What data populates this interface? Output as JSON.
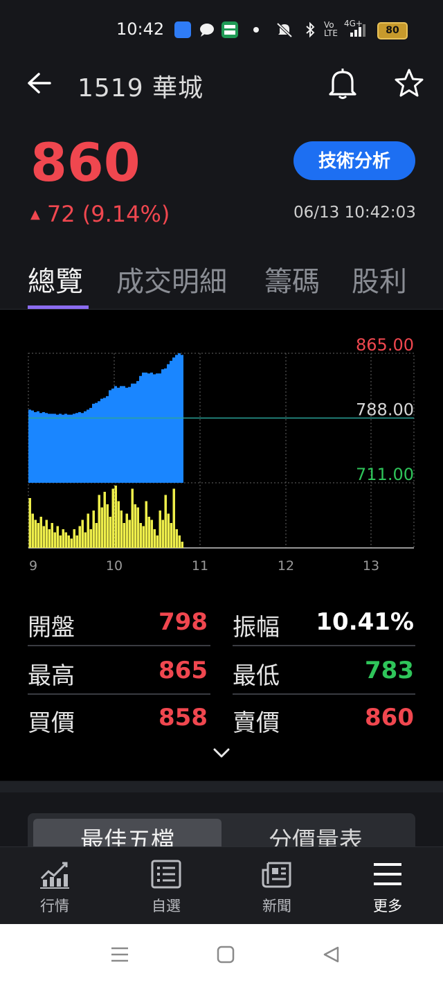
{
  "status_bar": {
    "time": "10:42",
    "volte_label": "Vo LTE",
    "network_label": "4G+",
    "battery": "80"
  },
  "header": {
    "title": "1519 華城"
  },
  "quote": {
    "price": "860",
    "change": "72 (9.14%)",
    "timestamp": "06/13 10:42:03",
    "tech_button": "技術分析",
    "colors": {
      "up": "#f0474f",
      "down": "#2fc55a",
      "accent": "#1d6ff2"
    }
  },
  "tabs": [
    {
      "label": "總覽",
      "active": true
    },
    {
      "label": "成交明細",
      "active": false
    },
    {
      "label": "籌碼",
      "active": false
    },
    {
      "label": "股利",
      "active": false
    }
  ],
  "chart_data": {
    "type": "area",
    "title": "",
    "y_labels": [
      "865.00",
      "788.00",
      "711.00"
    ],
    "ylim": [
      711,
      865
    ],
    "reference_price": 788,
    "x_ticks": [
      "9",
      "10",
      "11",
      "12",
      "13"
    ],
    "grid": true,
    "series": [
      {
        "values": [
          798,
          797,
          795,
          796,
          794,
          795,
          794,
          793,
          793,
          793,
          792,
          793,
          792,
          793,
          792,
          792,
          793,
          794,
          795,
          794,
          796,
          798,
          800,
          805,
          806,
          808,
          811,
          812,
          814,
          821,
          823,
          826,
          824,
          826,
          826,
          824,
          825,
          829,
          829,
          832,
          838,
          842,
          842,
          841,
          842,
          840,
          841,
          841,
          846,
          847,
          852,
          856,
          860,
          863,
          865,
          863
        ]
      },
      {
        "values": [
          80,
          55,
          45,
          40,
          50,
          35,
          45,
          30,
          40,
          25,
          35,
          20,
          30,
          25,
          20,
          15,
          30,
          20,
          35,
          45,
          25,
          55,
          30,
          60,
          40,
          85,
          65,
          90,
          70,
          50,
          95,
          100,
          75,
          60,
          40,
          55,
          45,
          95,
          70,
          65,
          40,
          35,
          75,
          50,
          45,
          30,
          20,
          60,
          45,
          85,
          55,
          40,
          95,
          30,
          20,
          10
        ]
      }
    ]
  },
  "stats": {
    "open_label": "開盤",
    "open_value": "798",
    "amplitude_label": "振幅",
    "amplitude_value": "10.41%",
    "high_label": "最高",
    "high_value": "865",
    "low_label": "最低",
    "low_value": "783",
    "bid_label": "買價",
    "bid_value": "858",
    "ask_label": "賣價",
    "ask_value": "860"
  },
  "segmented": {
    "left": "最佳五檔",
    "right": "分價量表"
  },
  "bottom_nav": [
    {
      "label": "行情",
      "icon": "chart-icon"
    },
    {
      "label": "自選",
      "icon": "list-icon"
    },
    {
      "label": "新聞",
      "icon": "news-icon"
    },
    {
      "label": "更多",
      "icon": "menu-icon"
    }
  ]
}
